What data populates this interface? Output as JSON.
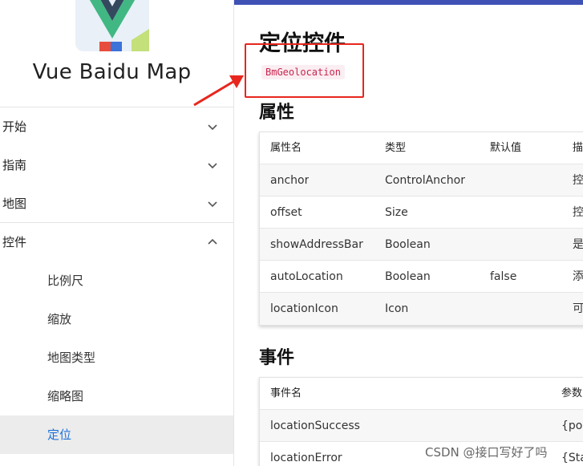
{
  "sidebar": {
    "app_title": "Vue Baidu Map",
    "nav": [
      {
        "label": "开始",
        "expanded": false
      },
      {
        "label": "指南",
        "expanded": false
      },
      {
        "label": "地图",
        "expanded": false
      },
      {
        "label": "控件",
        "expanded": true
      }
    ],
    "sub_items": [
      {
        "label": "比例尺",
        "active": false
      },
      {
        "label": "缩放",
        "active": false
      },
      {
        "label": "地图类型",
        "active": false
      },
      {
        "label": "缩略图",
        "active": false
      },
      {
        "label": "定位",
        "active": true
      }
    ]
  },
  "main": {
    "page_title": "定位控件",
    "component_tag": "BmGeolocation",
    "props_section": {
      "title": "属性",
      "headers": [
        "属性名",
        "类型",
        "默认值",
        "描"
      ],
      "rows": [
        [
          "anchor",
          "ControlAnchor",
          "",
          "控"
        ],
        [
          "offset",
          "Size",
          "",
          "控"
        ],
        [
          "showAddressBar",
          "Boolean",
          "",
          "是"
        ],
        [
          "autoLocation",
          "Boolean",
          "false",
          "添"
        ],
        [
          "locationIcon",
          "Icon",
          "",
          "可"
        ]
      ]
    },
    "events_section": {
      "title": "事件",
      "headers": [
        "事件名",
        "参数"
      ],
      "rows": [
        [
          "locationSuccess",
          "{poi"
        ],
        [
          "locationError",
          "{Stat"
        ]
      ]
    }
  },
  "watermark": "CSDN @接口写好了吗",
  "colors": {
    "accent_bar": "#3f51b5",
    "active_link": "#1e6fd9",
    "annotation_red": "#e8261d",
    "code_text": "#c7254e"
  }
}
